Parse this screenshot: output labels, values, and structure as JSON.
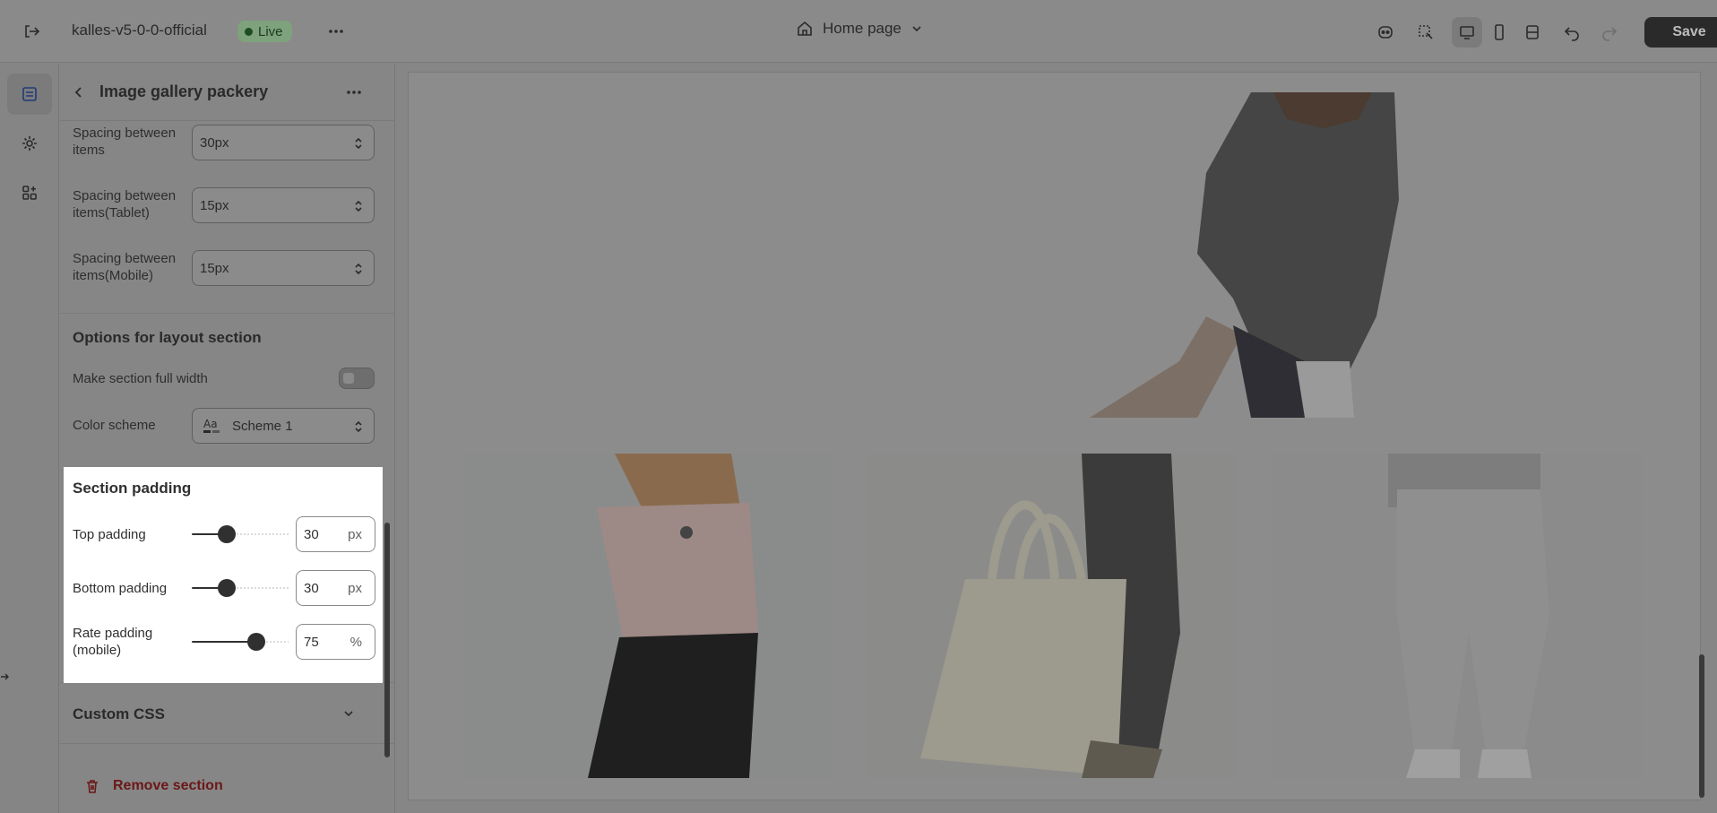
{
  "topbar": {
    "store_name": "kalles-v5-0-0-official",
    "live_label": "Live",
    "page_name": "Home page",
    "save_label": "Save"
  },
  "panel": {
    "title": "Image gallery packery",
    "spacing": [
      {
        "label": "Spacing between items",
        "value": "30px"
      },
      {
        "label": "Spacing between items(Tablet)",
        "value": "15px"
      },
      {
        "label": "Spacing between items(Mobile)",
        "value": "15px"
      }
    ],
    "layout_group_title": "Options for layout section",
    "full_width_label": "Make section full width",
    "full_width_on": false,
    "color_scheme_label": "Color scheme",
    "color_scheme_value": "Scheme 1",
    "padding": {
      "title": "Section padding",
      "top_label": "Top padding",
      "top_value": "30",
      "top_unit": "px",
      "top_fraction": 0.33,
      "bottom_label": "Bottom padding",
      "bottom_value": "30",
      "bottom_unit": "px",
      "bottom_fraction": 0.33,
      "rate_label": "Rate padding (mobile)",
      "rate_value": "75",
      "rate_unit": "%",
      "rate_fraction": 0.7
    },
    "custom_css_label": "Custom CSS",
    "remove_label": "Remove section"
  },
  "colors": {
    "highlight_bg": "#ffffff",
    "save_bg": "#2a2a2a",
    "remove_text": "#6b1717",
    "live_badge": "#7ea27c"
  }
}
